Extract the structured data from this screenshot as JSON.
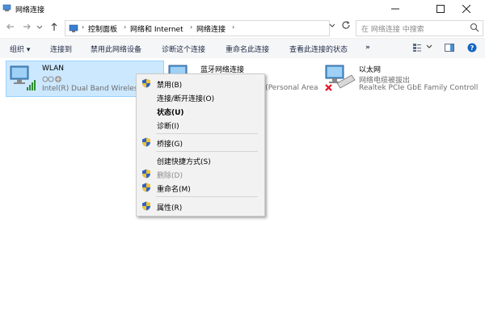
{
  "window": {
    "title": "网络连接"
  },
  "address": {
    "crumbs": [
      "控制面板",
      "网络和 Internet",
      "网络连接"
    ]
  },
  "search": {
    "placeholder": "在 网络连接 中搜索"
  },
  "toolbar": {
    "organize": "组织 ▾",
    "connect_to": "连接到",
    "disable_device": "禁用此网络设备",
    "diagnose": "诊断这个连接",
    "rename": "重命名此连接",
    "view_status": "查看此连接的状态",
    "more": "»"
  },
  "connections": [
    {
      "name": "WLAN",
      "status": "",
      "device": "Intel(R) Dual Band Wireless-AC"
    },
    {
      "name": "蓝牙网络连接",
      "status": "",
      "device": "Bluetooth Device (Personal Area Network)"
    },
    {
      "name": "以太网",
      "status": "网络电缆被拔出",
      "device": "Realtek PCIe GbE Family Controller"
    }
  ],
  "context_menu": {
    "items": [
      {
        "label": "禁用(B)"
      },
      {
        "label": "连接/断开连接(O)"
      },
      {
        "label": "状态(U)"
      },
      {
        "label": "诊断(I)"
      },
      {
        "label": "桥接(G)"
      },
      {
        "label": "创建快捷方式(S)"
      },
      {
        "label": "删除(D)"
      },
      {
        "label": "重命名(M)"
      },
      {
        "label": "属性(R)"
      }
    ]
  },
  "colors": {
    "selection_bg": "#cce8ff",
    "selection_border": "#99d1ff",
    "command_bar_bg": "#f5f6f8",
    "menu_bg": "#f2f2f2",
    "signal_green": "#2e8b2e",
    "error_red": "#e81123",
    "help_blue": "#1565c0"
  },
  "icons": {
    "app": "network-connections-icon",
    "back": "back-arrow-icon",
    "forward": "forward-arrow-icon",
    "recent": "recent-locations-icon",
    "up": "up-arrow-icon",
    "refresh": "refresh-icon",
    "search": "search-icon",
    "view": "change-view-icon",
    "preview": "preview-pane-icon",
    "help": "help-icon",
    "uac": "uac-shield-icon",
    "wlan": "wireless-network-icon",
    "bluetooth": "bluetooth-network-icon",
    "ethernet": "ethernet-network-icon"
  }
}
